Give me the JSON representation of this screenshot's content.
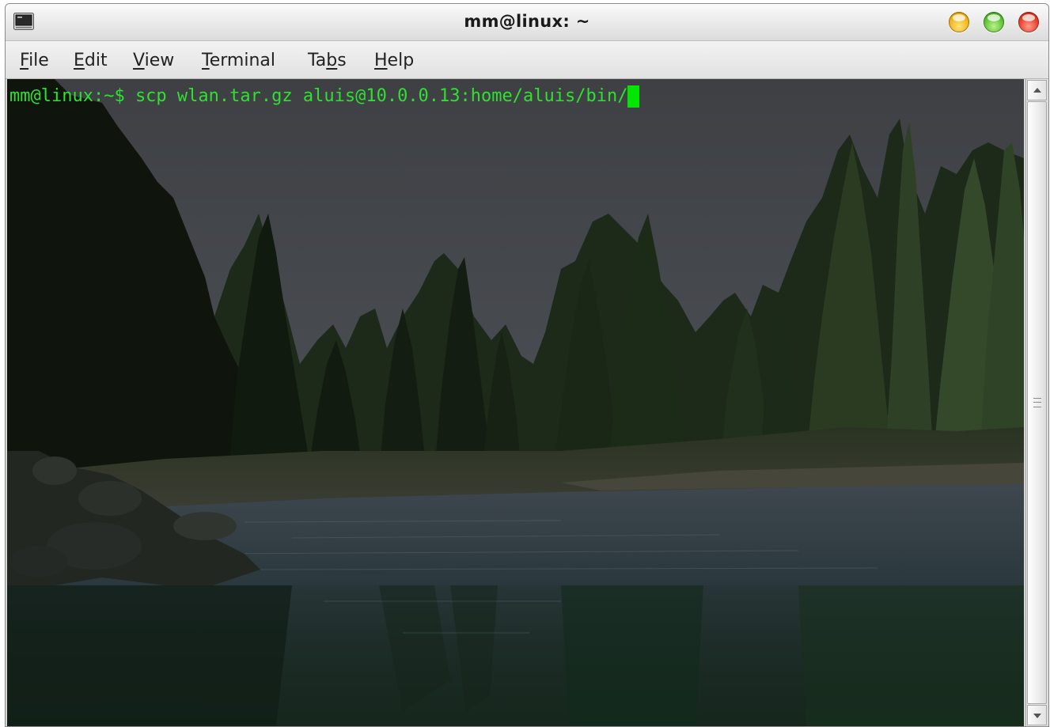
{
  "window": {
    "title": "mm@linux: ~"
  },
  "menu": {
    "items": [
      {
        "accel": "F",
        "rest": "ile"
      },
      {
        "accel": "E",
        "rest": "dit"
      },
      {
        "accel": "V",
        "rest": "iew"
      },
      {
        "accel": "T",
        "rest": "erminal"
      },
      {
        "pre": "Ta",
        "accel": "b",
        "rest": "s"
      },
      {
        "accel": "H",
        "rest": "elp"
      }
    ]
  },
  "terminal": {
    "line": "mm@linux:~$ scp wlan.tar.gz aluis@10.0.0.13:home/aluis/bin/",
    "text_color": "#2fe02f",
    "cursor_color": "#00e600"
  },
  "icons": {
    "app": "terminal-icon",
    "minimize": "minimize-icon",
    "maximize": "maximize-icon",
    "close": "close-icon"
  }
}
